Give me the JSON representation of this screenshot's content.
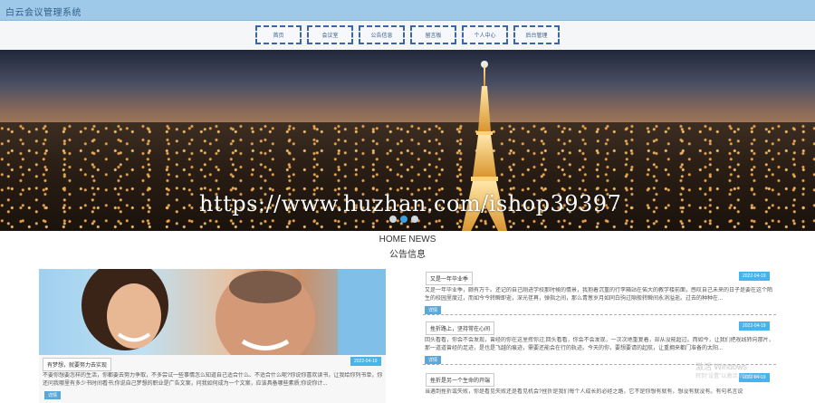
{
  "header": {
    "title": "白云会议管理系统"
  },
  "nav": {
    "items": [
      {
        "label": "首页"
      },
      {
        "label": "会议室"
      },
      {
        "label": "公告信息"
      },
      {
        "label": "留言板"
      },
      {
        "label": "个人中心"
      },
      {
        "label": "后台管理"
      }
    ]
  },
  "banner": {
    "watermark": "https://www.huzhan.com/ishop39397",
    "carousel_dots": 3,
    "active_dot": 2
  },
  "news": {
    "heading_en": "HOME NEWS",
    "heading_cn": "公告信息",
    "featured": {
      "title": "有梦想，就要努力去实现",
      "date": "2022-04-19",
      "excerpt": "不要你想要怎样的生活，你都要去努力争取，不多尝试一些事情怎么知道自己适合什么、不适合什么呢?你说你喜欢读书，让我给你列书单，你还问我哪里有多少书时间看书;你说自己梦想的职业是广告文案，问我如何成为一个文案，应该具备哪些素质;你说你计...",
      "badge": "详情"
    },
    "list": [
      {
        "title": "又是一年毕业季",
        "date": "2022-04-19",
        "excerpt": "又是一年毕业季，颇有万千。还记的自己刚进学校那时候的情景，我抱着沉重的行李箱站在偌大的教学楼前面，感叹自己未来的日子是要在这个陌生的校园里度过，而如今今转瞬即逝，深光荏苒，弹指之间，那么青葱岁月如同白驹过隙般转瞬间永消溢逝。过去的种种在...",
        "badge": "详情"
      },
      {
        "title": "挫折路上，坚持常在心间",
        "date": "2022-04-19",
        "excerpt": "回头看看，你会不会发现，曾经的你在这里挥你过;回头看看，你会不会发现，一次次地重复着，却从没能超过。而如今，让我们把视线转向那片，那一道道曾经的足迹，是也是飞越的痕迹，需要还能会在行的轨迹。今天的你，要想要请的起航，让重拥来都门准备的太阳...",
        "badge": "详情"
      },
      {
        "title": "挫折是另一个生命的开端",
        "date": "2022-04-19",
        "excerpt": "当遇到挫折或失败，你是看见失败还是看见机会?挫折是我们每个人成长的必经之路，它不是你想有就有，想没有就没有。有句名言说"
      }
    ]
  },
  "os_watermark": {
    "line1": "激活 Windows",
    "line2": "转到\"设置\"以激活 Windows。"
  }
}
